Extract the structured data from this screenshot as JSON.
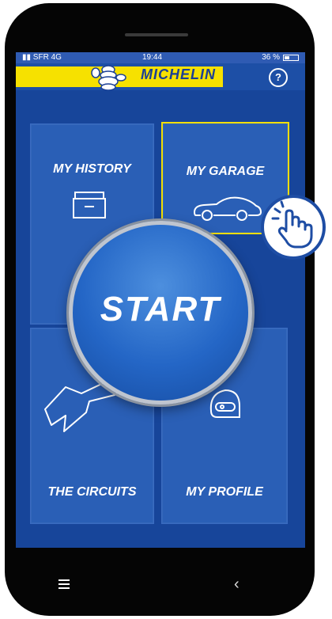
{
  "status_bar": {
    "carrier": "SFR 4G",
    "time": "19:44",
    "battery": "36 %"
  },
  "header": {
    "brand": "MICHELIN",
    "help_label": "?"
  },
  "tiles": {
    "history": "MY HISTORY",
    "garage": "MY GARAGE",
    "circuits": "THE CIRCUITS",
    "profile": "MY PROFILE"
  },
  "start_button": {
    "label": "START"
  },
  "colors": {
    "background": "#1e4da4",
    "tile": "#2a5fb6",
    "highlight": "#f3de00",
    "brand_yellow": "#f6e100"
  },
  "icons": {
    "history": "archive-box-icon",
    "garage": "car-icon",
    "circuits": "race-track-icon",
    "profile": "helmet-icon",
    "tap": "hand-tap-icon"
  }
}
